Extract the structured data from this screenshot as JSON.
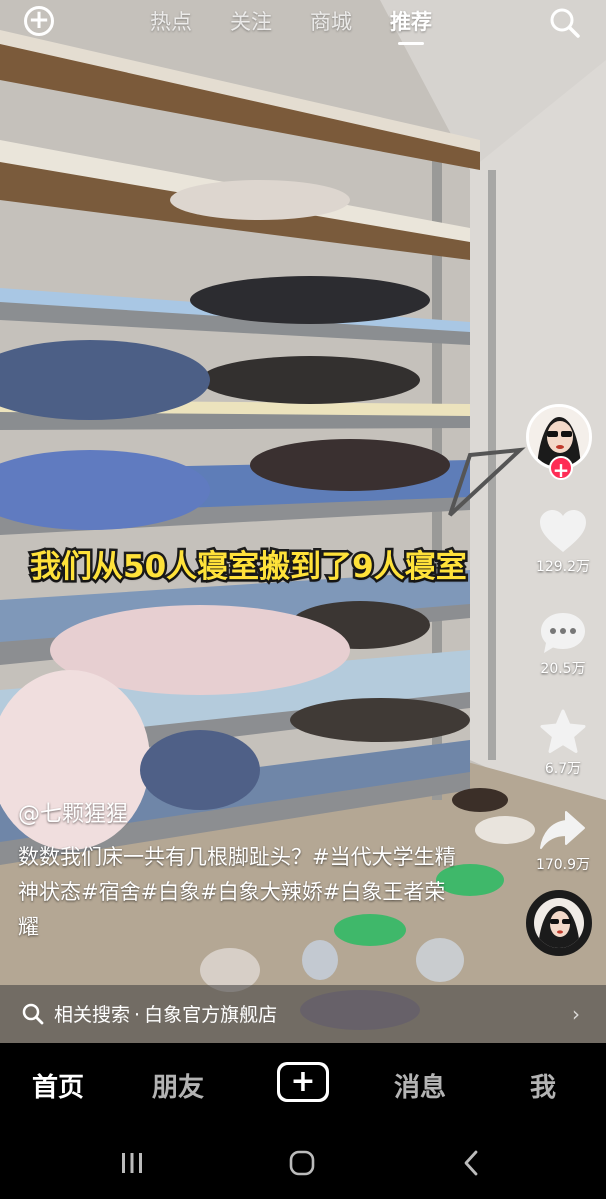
{
  "topnav": {
    "tabs": [
      {
        "label": "热点",
        "active": false
      },
      {
        "label": "关注",
        "active": false
      },
      {
        "label": "商城",
        "active": false
      },
      {
        "label": "推荐",
        "active": true
      }
    ]
  },
  "video": {
    "overlay_caption": "我们从50人寝室搬到了9人寝室"
  },
  "actions": {
    "likes": "129.2万",
    "comments": "20.5万",
    "favorites": "6.7万",
    "shares": "170.9万"
  },
  "post": {
    "author": "@七颗猩猩",
    "description": "数数我们床一共有几根脚趾头？#当代大学生精神状态#宿舍#白象#白象大辣娇#白象王者荣耀"
  },
  "related_search": {
    "prefix": "相关搜索",
    "separator": "·",
    "query": "白象官方旗舰店"
  },
  "bottombar": {
    "home": "首页",
    "friends": "朋友",
    "messages": "消息",
    "me": "我"
  },
  "colors": {
    "caption_yellow": "#ffe23a",
    "follow_red": "#fe2c55"
  }
}
